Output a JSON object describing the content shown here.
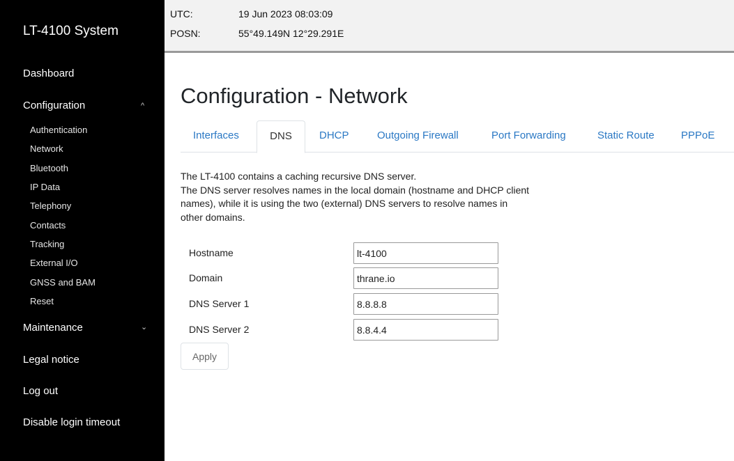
{
  "sidebar": {
    "brand": "LT-4100 System",
    "dashboard": "Dashboard",
    "configuration": {
      "label": "Configuration",
      "caret": "^",
      "items": [
        "Authentication",
        "Network",
        "Bluetooth",
        "IP Data",
        "Telephony",
        "Contacts",
        "Tracking",
        "External I/O",
        "GNSS and BAM",
        "Reset"
      ]
    },
    "maintenance": {
      "label": "Maintenance",
      "caret": "⌄"
    },
    "legal": "Legal notice",
    "logout": "Log out",
    "disable_timeout": "Disable login timeout"
  },
  "topbar": {
    "utc_label": "UTC:",
    "utc_value": "19 Jun 2023 08:03:09",
    "posn_label": "POSN:",
    "posn_value": "55°49.149N 12°29.291E"
  },
  "page": {
    "title": "Configuration - Network",
    "tabs": [
      "Interfaces",
      "DNS",
      "DHCP",
      "Outgoing Firewall",
      "Port Forwarding",
      "Static Route",
      "PPPoE"
    ],
    "active_tab": "DNS",
    "description": [
      "The LT-4100 contains a caching recursive DNS server.",
      "The DNS server resolves names in the local domain (hostname and DHCP client",
      "names), while it is using the two (external) DNS servers to resolve names in",
      "other domains."
    ],
    "form": {
      "hostname_label": "Hostname",
      "hostname_value": "lt-4100",
      "domain_label": "Domain",
      "domain_value": "thrane.io",
      "dns1_label": "DNS Server 1",
      "dns1_value": "8.8.8.8",
      "dns2_label": "DNS Server 2",
      "dns2_value": "8.8.4.4"
    },
    "apply_label": "Apply"
  },
  "colors": {
    "sidebar_bg": "#000000",
    "tab_link": "#2a78c4",
    "topbar_bg": "#f2f2f2"
  }
}
